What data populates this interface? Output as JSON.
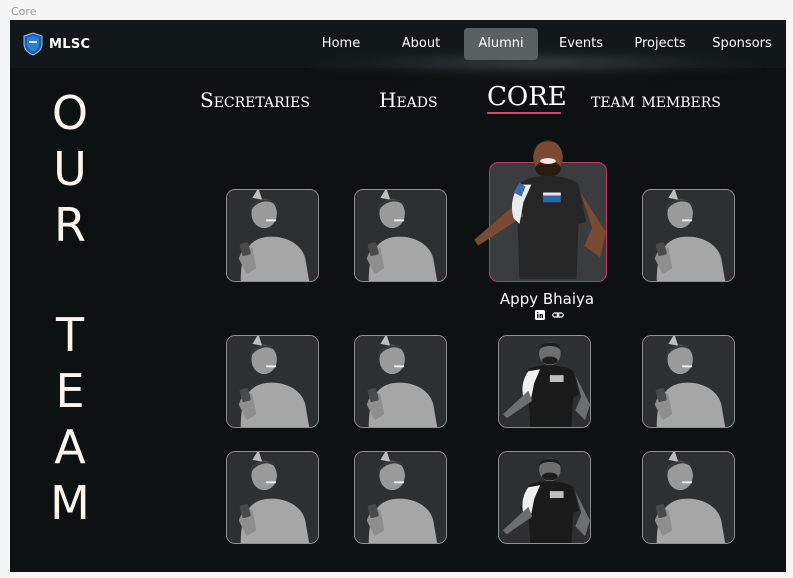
{
  "frame_label": "Core",
  "nav": {
    "brand": "MLSC",
    "items": [
      {
        "label": "Home"
      },
      {
        "label": "About"
      },
      {
        "label": "Alumni"
      },
      {
        "label": "Events"
      },
      {
        "label": "Projects"
      },
      {
        "label": "Sponsors"
      }
    ],
    "active": "Alumni"
  },
  "heading": {
    "letters": [
      "O",
      "U",
      "R",
      "T",
      "E",
      "A",
      "M"
    ]
  },
  "tabs": [
    {
      "label": "Secretaries"
    },
    {
      "label": "Heads"
    },
    {
      "label": "CORE"
    },
    {
      "label": "team members"
    }
  ],
  "active_tab": "CORE",
  "featured_member": {
    "name": "Appy Bhaiya",
    "socials": [
      "linkedin-icon",
      "link-icon"
    ]
  },
  "colors": {
    "background": "#0e1112",
    "accent": "#e0456d",
    "text": "#ffffff",
    "heading": "#fbf4ec"
  }
}
